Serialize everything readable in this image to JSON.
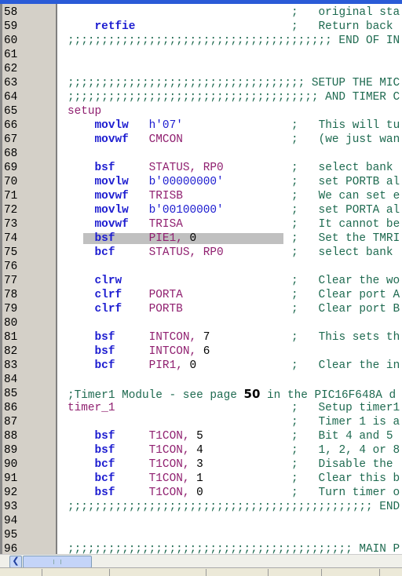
{
  "editor": {
    "highlighted_line": 74,
    "colors": {
      "keyword": "#1c1cd0",
      "operand": "#902070",
      "comment": "#1e6a50",
      "highlight": "#c0c0c0",
      "gutter": "#d4d0c8"
    },
    "lines": [
      {
        "n": "58",
        "segs": [
          {
            "t": "                                 ;   ",
            "c": "cm"
          },
          {
            "t": "original sta",
            "c": "cm"
          }
        ]
      },
      {
        "n": "59",
        "segs": [
          {
            "t": "    "
          },
          {
            "t": "retfie",
            "c": "kw"
          },
          {
            "t": "                       "
          },
          {
            "t": ";   Return back",
            "c": "cm"
          }
        ]
      },
      {
        "n": "60",
        "segs": [
          {
            "t": ";;;;;;;;;;;;;;;;;;;;;;;;;;;;;;;;;;;;;;; END OF IN",
            "c": "cm"
          }
        ]
      },
      {
        "n": "61",
        "segs": []
      },
      {
        "n": "62",
        "segs": []
      },
      {
        "n": "63",
        "segs": [
          {
            "t": ";;;;;;;;;;;;;;;;;;;;;;;;;;;;;;;;;;; SETUP THE MIC",
            "c": "cm"
          }
        ]
      },
      {
        "n": "64",
        "segs": [
          {
            "t": ";;;;;;;;;;;;;;;;;;;;;;;;;;;;;;;;;;;;; AND TIMER C",
            "c": "cm"
          }
        ]
      },
      {
        "n": "65",
        "segs": [
          {
            "t": "setup",
            "c": "op"
          }
        ]
      },
      {
        "n": "66",
        "segs": [
          {
            "t": "    "
          },
          {
            "t": "movlw",
            "c": "kw"
          },
          {
            "t": "   "
          },
          {
            "t": "h'07'",
            "c": "kw",
            "w": "normal"
          },
          {
            "t": "                "
          },
          {
            "t": ";   This will tu",
            "c": "cm"
          }
        ]
      },
      {
        "n": "67",
        "segs": [
          {
            "t": "    "
          },
          {
            "t": "movwf",
            "c": "kw"
          },
          {
            "t": "   "
          },
          {
            "t": "CMCON",
            "c": "op"
          },
          {
            "t": "                "
          },
          {
            "t": ";   (we just wan",
            "c": "cm"
          }
        ]
      },
      {
        "n": "68",
        "segs": []
      },
      {
        "n": "69",
        "segs": [
          {
            "t": "    "
          },
          {
            "t": "bsf",
            "c": "kw"
          },
          {
            "t": "     "
          },
          {
            "t": "STATUS, RP0",
            "c": "op"
          },
          {
            "t": "          "
          },
          {
            "t": ";   select bank",
            "c": "cm"
          }
        ]
      },
      {
        "n": "70",
        "segs": [
          {
            "t": "    "
          },
          {
            "t": "movlw",
            "c": "kw"
          },
          {
            "t": "   "
          },
          {
            "t": "b'00000000'",
            "c": "kw",
            "w": "normal"
          },
          {
            "t": "          "
          },
          {
            "t": ";   set PORTB al",
            "c": "cm"
          }
        ]
      },
      {
        "n": "71",
        "segs": [
          {
            "t": "    "
          },
          {
            "t": "movwf",
            "c": "kw"
          },
          {
            "t": "   "
          },
          {
            "t": "TRISB",
            "c": "op"
          },
          {
            "t": "                "
          },
          {
            "t": ";   We can set e",
            "c": "cm"
          }
        ]
      },
      {
        "n": "72",
        "segs": [
          {
            "t": "    "
          },
          {
            "t": "movlw",
            "c": "kw"
          },
          {
            "t": "   "
          },
          {
            "t": "b'00100000'",
            "c": "kw",
            "w": "normal"
          },
          {
            "t": "          "
          },
          {
            "t": ";   set PORTA al",
            "c": "cm"
          }
        ]
      },
      {
        "n": "73",
        "segs": [
          {
            "t": "    "
          },
          {
            "t": "movwf",
            "c": "kw"
          },
          {
            "t": "   "
          },
          {
            "t": "TRISA",
            "c": "op"
          },
          {
            "t": "                "
          },
          {
            "t": ";   It cannot be",
            "c": "cm"
          }
        ]
      },
      {
        "n": "74",
        "segs": [
          {
            "t": "    "
          },
          {
            "t": "bsf",
            "c": "kw"
          },
          {
            "t": "     "
          },
          {
            "t": "PIE1, ",
            "c": "op"
          },
          {
            "t": "0",
            "c": "n"
          },
          {
            "t": "              "
          },
          {
            "t": ";   Set the TMRI",
            "c": "cm"
          }
        ]
      },
      {
        "n": "75",
        "segs": [
          {
            "t": "    "
          },
          {
            "t": "bcf",
            "c": "kw"
          },
          {
            "t": "     "
          },
          {
            "t": "STATUS, RP0",
            "c": "op"
          },
          {
            "t": "          "
          },
          {
            "t": ";   select bank",
            "c": "cm"
          }
        ]
      },
      {
        "n": "76",
        "segs": []
      },
      {
        "n": "77",
        "segs": [
          {
            "t": "    "
          },
          {
            "t": "clrw",
            "c": "kw"
          },
          {
            "t": "                         "
          },
          {
            "t": ";   Clear the wo",
            "c": "cm"
          }
        ]
      },
      {
        "n": "78",
        "segs": [
          {
            "t": "    "
          },
          {
            "t": "clrf",
            "c": "kw"
          },
          {
            "t": "    "
          },
          {
            "t": "PORTA",
            "c": "op"
          },
          {
            "t": "                "
          },
          {
            "t": ";   Clear port A",
            "c": "cm"
          }
        ]
      },
      {
        "n": "79",
        "segs": [
          {
            "t": "    "
          },
          {
            "t": "clrf",
            "c": "kw"
          },
          {
            "t": "    "
          },
          {
            "t": "PORTB",
            "c": "op"
          },
          {
            "t": "                "
          },
          {
            "t": ";   Clear port B",
            "c": "cm"
          }
        ]
      },
      {
        "n": "80",
        "segs": []
      },
      {
        "n": "81",
        "segs": [
          {
            "t": "    "
          },
          {
            "t": "bsf",
            "c": "kw"
          },
          {
            "t": "     "
          },
          {
            "t": "INTCON, ",
            "c": "op"
          },
          {
            "t": "7",
            "c": "n"
          },
          {
            "t": "            "
          },
          {
            "t": ";   This sets th",
            "c": "cm"
          }
        ]
      },
      {
        "n": "82",
        "segs": [
          {
            "t": "    "
          },
          {
            "t": "bsf",
            "c": "kw"
          },
          {
            "t": "     "
          },
          {
            "t": "INTCON, ",
            "c": "op"
          },
          {
            "t": "6",
            "c": "n"
          }
        ]
      },
      {
        "n": "83",
        "segs": [
          {
            "t": "    "
          },
          {
            "t": "bcf",
            "c": "kw"
          },
          {
            "t": "     "
          },
          {
            "t": "PIR1, ",
            "c": "op"
          },
          {
            "t": "0",
            "c": "n"
          },
          {
            "t": "              "
          },
          {
            "t": ";   Clear the in",
            "c": "cm"
          }
        ]
      },
      {
        "n": "84",
        "segs": []
      },
      {
        "n": "85",
        "segs": [
          {
            "t": ";Timer1 Module - see page ",
            "c": "cm"
          },
          {
            "t": "50",
            "c": "big"
          },
          {
            "t": " in the PIC16F648A d",
            "c": "cm"
          }
        ]
      },
      {
        "n": "86",
        "segs": [
          {
            "t": "timer_1",
            "c": "op"
          },
          {
            "t": "                          "
          },
          {
            "t": ";   Setup timer1",
            "c": "cm"
          }
        ]
      },
      {
        "n": "87",
        "segs": [
          {
            "t": "                                 "
          },
          {
            "t": ";   Timer 1 is a",
            "c": "cm"
          }
        ]
      },
      {
        "n": "88",
        "segs": [
          {
            "t": "    "
          },
          {
            "t": "bsf",
            "c": "kw"
          },
          {
            "t": "     "
          },
          {
            "t": "T1CON, ",
            "c": "op"
          },
          {
            "t": "5",
            "c": "n"
          },
          {
            "t": "             "
          },
          {
            "t": ";   Bit 4 and 5",
            "c": "cm"
          }
        ]
      },
      {
        "n": "89",
        "segs": [
          {
            "t": "    "
          },
          {
            "t": "bsf",
            "c": "kw"
          },
          {
            "t": "     "
          },
          {
            "t": "T1CON, ",
            "c": "op"
          },
          {
            "t": "4",
            "c": "n"
          },
          {
            "t": "             "
          },
          {
            "t": ";   1, 2, 4 or 8",
            "c": "cm"
          }
        ]
      },
      {
        "n": "90",
        "segs": [
          {
            "t": "    "
          },
          {
            "t": "bcf",
            "c": "kw"
          },
          {
            "t": "     "
          },
          {
            "t": "T1CON, ",
            "c": "op"
          },
          {
            "t": "3",
            "c": "n"
          },
          {
            "t": "             "
          },
          {
            "t": ";   Disable the",
            "c": "cm"
          }
        ]
      },
      {
        "n": "91",
        "segs": [
          {
            "t": "    "
          },
          {
            "t": "bcf",
            "c": "kw"
          },
          {
            "t": "     "
          },
          {
            "t": "T1CON, ",
            "c": "op"
          },
          {
            "t": "1",
            "c": "n"
          },
          {
            "t": "             "
          },
          {
            "t": ";   Clear this b",
            "c": "cm"
          }
        ]
      },
      {
        "n": "92",
        "segs": [
          {
            "t": "    "
          },
          {
            "t": "bsf",
            "c": "kw"
          },
          {
            "t": "     "
          },
          {
            "t": "T1CON, ",
            "c": "op"
          },
          {
            "t": "0",
            "c": "n"
          },
          {
            "t": "             "
          },
          {
            "t": ";   Turn timer o",
            "c": "cm"
          }
        ]
      },
      {
        "n": "93",
        "segs": [
          {
            "t": ";;;;;;;;;;;;;;;;;;;;;;;;;;;;;;;;;;;;;;;;;;;;; END",
            "c": "cm"
          }
        ]
      },
      {
        "n": "94",
        "segs": []
      },
      {
        "n": "95",
        "segs": []
      },
      {
        "n": "96",
        "segs": [
          {
            "t": ";;;;;;;;;;;;;;;;;;;;;;;;;;;;;;;;;;;;;;;;;; MAIN P",
            "c": "cm"
          }
        ]
      }
    ]
  },
  "scrollbar": {
    "left_arrow_icon": "chevron-left-icon",
    "position_percent": 5
  }
}
